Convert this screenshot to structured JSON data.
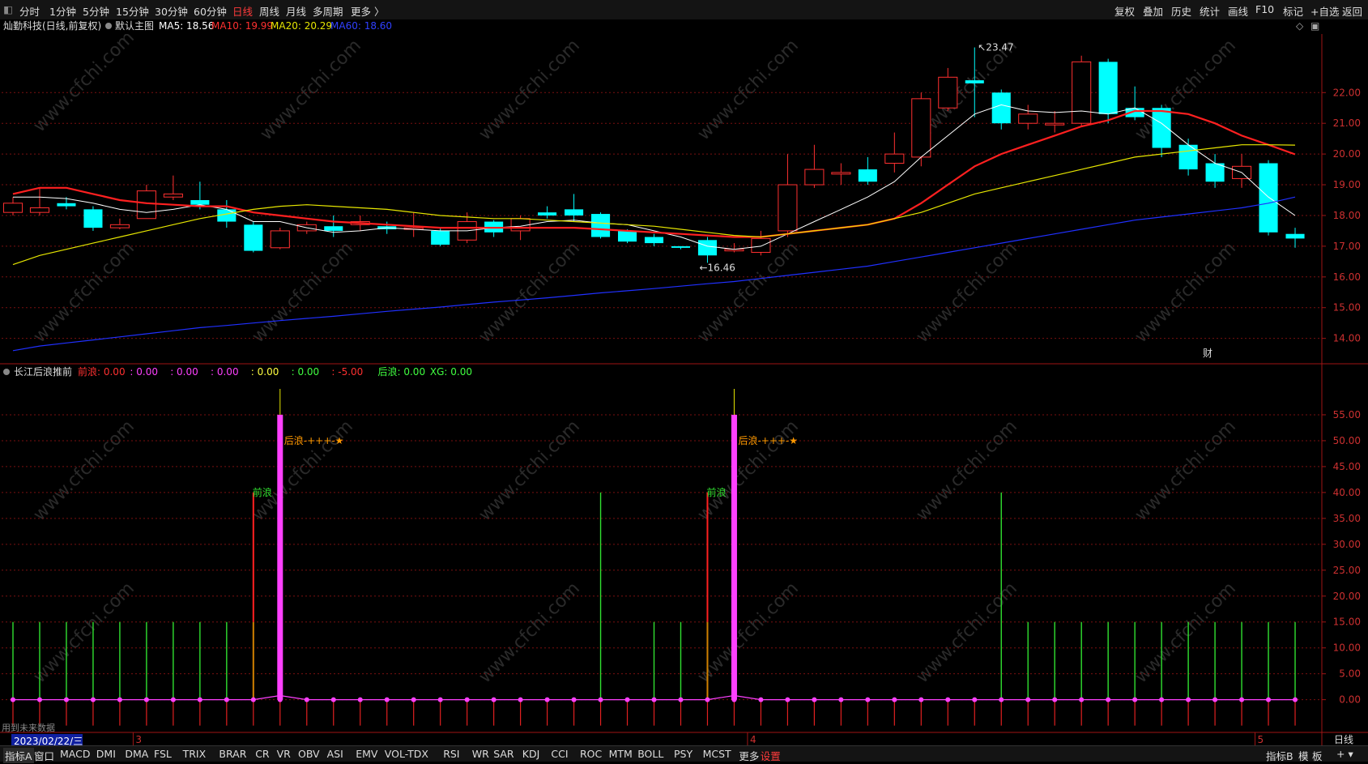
{
  "toolbar": {
    "periods": [
      "分时",
      "1分钟",
      "5分钟",
      "15分钟",
      "30分钟",
      "60分钟",
      "日线",
      "周线",
      "月线",
      "多周期",
      "更多 〉"
    ],
    "active_period": "日线",
    "right_buttons": [
      "复权",
      "叠加",
      "历史",
      "统计",
      "画线",
      "F10",
      "标记",
      "+自选",
      "返回"
    ]
  },
  "main_header": {
    "stock": "灿勤科技(日线,前复权)",
    "template": "默认主图",
    "ma5": "MA5: 18.56",
    "ma10": "MA10: 19.99",
    "ma20": "MA20: 20.29",
    "ma60": "MA60: 18.60"
  },
  "sub_header": {
    "name": "长江后浪推前",
    "items": [
      {
        "text": "前浪: 0.00",
        "color": "#ff3030"
      },
      {
        "text": ": 0.00",
        "color": "#ff40ff"
      },
      {
        "text": ": 0.00",
        "color": "#ff40ff"
      },
      {
        "text": ": 0.00",
        "color": "#ff40ff"
      },
      {
        "text": ": 0.00",
        "color": "#ffff40"
      },
      {
        "text": ": 0.00",
        "color": "#40ff40"
      },
      {
        "text": ": -5.00",
        "color": "#ff3030"
      },
      {
        "text": "后浪: 0.00",
        "color": "#40ff40"
      },
      {
        "text": "XG: 0.00",
        "color": "#40ff40"
      }
    ]
  },
  "annotations": {
    "high_label": "23.47",
    "low_label": "16.46",
    "cai_badge": "财",
    "qianlang": "前浪",
    "houlang": "后浪-+++-★",
    "watermark": "www.cfchi.com"
  },
  "x_axis": {
    "date_label": "2023/02/22/三",
    "month_marks": [
      {
        "label": "3",
        "index": 5
      },
      {
        "label": "4",
        "index": 28
      },
      {
        "label": "5",
        "index": 47
      }
    ],
    "period_label": "日线",
    "future_data": "用到未来数据"
  },
  "bottom_tabs": {
    "left": "指标A",
    "window": "窗口",
    "items": [
      "MACD",
      "DMI",
      "DMA",
      "FSL",
      "TRIX",
      "BRAR",
      "CR",
      "VR",
      "OBV",
      "ASI",
      "EMV",
      "VOL-TDX",
      "RSI",
      "WR",
      "SAR",
      "KDJ",
      "CCI",
      "ROC",
      "MTM",
      "BOLL",
      "PSY",
      "MCST",
      "更多",
      "设置"
    ],
    "active": "设置",
    "right": [
      "指标B",
      "模",
      "板"
    ]
  },
  "colors": {
    "up": "#ff3030",
    "down": "#00ffff",
    "ma5": "#ffffff",
    "ma10": "#ff2020",
    "ma20": "#e6e600",
    "ma60": "#2030ff",
    "grid": "#7a1010",
    "axis_text": "#cc3030"
  },
  "chart_data": [
    {
      "type": "candlestick",
      "title": "灿勤科技(日线,前复权)",
      "ylim": [
        13.2,
        23.8
      ],
      "y_ticks": [
        14,
        15,
        16,
        17,
        18,
        19,
        20,
        21,
        22
      ],
      "y_tick_labels": [
        "14.00",
        "15.00",
        "16.00",
        "17.00",
        "18.00",
        "19.00",
        "20.00",
        "21.00",
        "22.00"
      ],
      "candles": [
        {
          "o": 18.1,
          "c": 18.4,
          "h": 18.6,
          "l": 18.0
        },
        {
          "o": 18.1,
          "c": 18.25,
          "h": 18.9,
          "l": 18.0
        },
        {
          "o": 18.4,
          "c": 18.3,
          "h": 18.6,
          "l": 18.2
        },
        {
          "o": 18.2,
          "c": 17.6,
          "h": 18.3,
          "l": 17.5
        },
        {
          "o": 17.6,
          "c": 17.7,
          "h": 17.9,
          "l": 17.55
        },
        {
          "o": 17.9,
          "c": 18.8,
          "h": 19.0,
          "l": 17.9
        },
        {
          "o": 18.6,
          "c": 18.7,
          "h": 19.3,
          "l": 18.5
        },
        {
          "o": 18.5,
          "c": 18.35,
          "h": 19.1,
          "l": 18.2
        },
        {
          "o": 18.2,
          "c": 17.8,
          "h": 18.5,
          "l": 17.6
        },
        {
          "o": 17.7,
          "c": 16.85,
          "h": 17.8,
          "l": 16.8
        },
        {
          "o": 16.95,
          "c": 17.5,
          "h": 17.6,
          "l": 16.9
        },
        {
          "o": 17.5,
          "c": 17.7,
          "h": 17.8,
          "l": 17.4
        },
        {
          "o": 17.65,
          "c": 17.5,
          "h": 18.0,
          "l": 17.3
        },
        {
          "o": 17.7,
          "c": 17.8,
          "h": 18.0,
          "l": 17.5
        },
        {
          "o": 17.65,
          "c": 17.55,
          "h": 17.8,
          "l": 17.4
        },
        {
          "o": 17.6,
          "c": 17.6,
          "h": 18.1,
          "l": 17.3
        },
        {
          "o": 17.5,
          "c": 17.05,
          "h": 17.6,
          "l": 17.0
        },
        {
          "o": 17.2,
          "c": 17.8,
          "h": 18.1,
          "l": 17.1
        },
        {
          "o": 17.8,
          "c": 17.45,
          "h": 17.85,
          "l": 17.3
        },
        {
          "o": 17.5,
          "c": 17.9,
          "h": 18.0,
          "l": 17.2
        },
        {
          "o": 18.1,
          "c": 18.0,
          "h": 18.3,
          "l": 17.9
        },
        {
          "o": 18.2,
          "c": 18.0,
          "h": 18.7,
          "l": 17.8
        },
        {
          "o": 18.05,
          "c": 17.3,
          "h": 18.1,
          "l": 17.25
        },
        {
          "o": 17.5,
          "c": 17.15,
          "h": 17.55,
          "l": 17.1
        },
        {
          "o": 17.3,
          "c": 17.1,
          "h": 17.4,
          "l": 17.0
        },
        {
          "o": 17.0,
          "c": 16.95,
          "h": 17.0,
          "l": 16.9
        },
        {
          "o": 17.2,
          "c": 16.7,
          "h": 17.3,
          "l": 16.46
        },
        {
          "o": 16.9,
          "c": 16.9,
          "h": 17.1,
          "l": 16.8
        },
        {
          "o": 16.8,
          "c": 17.25,
          "h": 17.5,
          "l": 16.7
        },
        {
          "o": 17.5,
          "c": 19.0,
          "h": 20.0,
          "l": 17.3
        },
        {
          "o": 19.0,
          "c": 19.5,
          "h": 20.3,
          "l": 18.9
        },
        {
          "o": 19.4,
          "c": 19.4,
          "h": 19.7,
          "l": 19.0
        },
        {
          "o": 19.5,
          "c": 19.1,
          "h": 19.9,
          "l": 19.0
        },
        {
          "o": 19.7,
          "c": 20.0,
          "h": 20.7,
          "l": 19.4
        },
        {
          "o": 19.9,
          "c": 21.8,
          "h": 22.0,
          "l": 19.6
        },
        {
          "o": 21.5,
          "c": 22.5,
          "h": 22.8,
          "l": 21.4
        },
        {
          "o": 22.4,
          "c": 22.3,
          "h": 23.47,
          "l": 21.2
        },
        {
          "o": 22.0,
          "c": 21.0,
          "h": 22.1,
          "l": 20.8
        },
        {
          "o": 21.0,
          "c": 21.3,
          "h": 21.6,
          "l": 20.8
        },
        {
          "o": 21.0,
          "c": 21.0,
          "h": 21.4,
          "l": 20.7
        },
        {
          "o": 21.0,
          "c": 23.0,
          "h": 23.2,
          "l": 20.9
        },
        {
          "o": 23.0,
          "c": 21.3,
          "h": 23.1,
          "l": 21.0
        },
        {
          "o": 21.5,
          "c": 21.2,
          "h": 22.2,
          "l": 21.1
        },
        {
          "o": 21.5,
          "c": 20.2,
          "h": 21.6,
          "l": 19.9
        },
        {
          "o": 20.3,
          "c": 19.5,
          "h": 20.5,
          "l": 19.3
        },
        {
          "o": 19.7,
          "c": 19.1,
          "h": 20.0,
          "l": 18.9
        },
        {
          "o": 19.2,
          "c": 19.6,
          "h": 20.0,
          "l": 18.9
        },
        {
          "o": 19.7,
          "c": 17.45,
          "h": 19.8,
          "l": 17.35
        },
        {
          "o": 17.4,
          "c": 17.25,
          "h": 17.6,
          "l": 16.95
        }
      ],
      "series": [
        {
          "name": "MA5",
          "values": [
            18.6,
            18.6,
            18.55,
            18.4,
            18.2,
            18.1,
            18.2,
            18.35,
            18.2,
            17.8,
            17.8,
            17.6,
            17.45,
            17.5,
            17.6,
            17.55,
            17.5,
            17.5,
            17.6,
            17.65,
            17.8,
            17.85,
            17.75,
            17.7,
            17.5,
            17.3,
            17.0,
            16.9,
            17.0,
            17.4,
            17.8,
            18.2,
            18.6,
            19.1,
            19.9,
            20.6,
            21.3,
            21.6,
            21.4,
            21.35,
            21.4,
            21.3,
            21.5,
            21.0,
            20.3,
            19.7,
            19.4,
            18.6,
            18.0
          ]
        },
        {
          "name": "MA10",
          "values": [
            18.7,
            18.9,
            18.9,
            18.7,
            18.5,
            18.4,
            18.35,
            18.3,
            18.3,
            18.1,
            18.0,
            17.9,
            17.8,
            17.75,
            17.7,
            17.65,
            17.6,
            17.6,
            17.6,
            17.6,
            17.6,
            17.6,
            17.55,
            17.5,
            17.45,
            17.4,
            17.35,
            17.3,
            17.3,
            17.4,
            17.5,
            17.6,
            17.7,
            17.9,
            18.4,
            19.0,
            19.6,
            20.0,
            20.3,
            20.6,
            20.9,
            21.1,
            21.4,
            21.4,
            21.3,
            21.0,
            20.6,
            20.3,
            19.99
          ]
        },
        {
          "name": "MA20",
          "values": [
            16.4,
            16.7,
            16.9,
            17.1,
            17.3,
            17.5,
            17.7,
            17.9,
            18.05,
            18.2,
            18.3,
            18.35,
            18.3,
            18.25,
            18.2,
            18.1,
            18.0,
            17.95,
            17.9,
            17.9,
            17.85,
            17.8,
            17.75,
            17.7,
            17.65,
            17.55,
            17.45,
            17.35,
            17.3,
            17.4,
            17.5,
            17.6,
            17.7,
            17.9,
            18.1,
            18.4,
            18.7,
            18.9,
            19.1,
            19.3,
            19.5,
            19.7,
            19.9,
            20.0,
            20.1,
            20.2,
            20.3,
            20.3,
            20.29
          ]
        },
        {
          "name": "MA60",
          "values": [
            13.6,
            13.75,
            13.85,
            13.95,
            14.05,
            14.15,
            14.25,
            14.35,
            14.42,
            14.5,
            14.58,
            14.65,
            14.72,
            14.8,
            14.88,
            14.95,
            15.02,
            15.1,
            15.18,
            15.25,
            15.32,
            15.4,
            15.48,
            15.55,
            15.62,
            15.7,
            15.78,
            15.85,
            15.95,
            16.05,
            16.15,
            16.25,
            16.35,
            16.5,
            16.65,
            16.8,
            16.95,
            17.1,
            17.25,
            17.4,
            17.55,
            17.7,
            17.85,
            17.95,
            18.05,
            18.15,
            18.25,
            18.4,
            18.6
          ]
        }
      ]
    },
    {
      "type": "bar",
      "title": "长江后浪推前",
      "ylim": [
        -6,
        60
      ],
      "y_ticks": [
        0,
        5,
        10,
        15,
        20,
        25,
        30,
        35,
        40,
        45,
        50,
        55
      ],
      "y_tick_labels": [
        "0.00",
        "5.00",
        "10.00",
        "15.00",
        "20.00",
        "25.00",
        "30.00",
        "35.00",
        "40.00",
        "45.00",
        "50.00",
        "55.00"
      ],
      "green_bars": [
        15,
        15,
        15,
        15,
        15,
        15,
        15,
        15,
        15,
        0,
        0,
        0,
        0,
        0,
        0,
        0,
        0,
        0,
        0,
        0,
        0,
        0,
        40,
        0,
        15,
        15,
        15,
        0,
        0,
        0,
        0,
        0,
        0,
        0,
        0,
        0,
        0,
        0,
        0,
        0,
        0,
        0,
        0,
        0,
        0,
        0,
        0,
        0,
        15
      ],
      "green_bars_tail": [
        0,
        0,
        0,
        0,
        0,
        0,
        0,
        0,
        0,
        0,
        0,
        0,
        0,
        0,
        0,
        0,
        0,
        0,
        0,
        0,
        0,
        0,
        0,
        0,
        0,
        0,
        0,
        0,
        0,
        0,
        0,
        0,
        0,
        0,
        0,
        0,
        0,
        40,
        15,
        15,
        15,
        15,
        15,
        15,
        15,
        15,
        15,
        15,
        15
      ],
      "red_bars": [
        0,
        0,
        0,
        0,
        0,
        0,
        0,
        0,
        0,
        40,
        0,
        0,
        0,
        0,
        0,
        0,
        0,
        0,
        0,
        0,
        0,
        0,
        0,
        0,
        0,
        0,
        40,
        0,
        0,
        0,
        0,
        0,
        0,
        0,
        0,
        0,
        0,
        0,
        0,
        0,
        0,
        0,
        0,
        0,
        0,
        0,
        0,
        0,
        0
      ],
      "magenta_bars": [
        0,
        0,
        0,
        0,
        0,
        0,
        0,
        0,
        0,
        0,
        55,
        0,
        0,
        0,
        0,
        0,
        0,
        0,
        0,
        0,
        0,
        0,
        0,
        0,
        0,
        0,
        0,
        55,
        0,
        0,
        0,
        0,
        0,
        0,
        0,
        0,
        0,
        0,
        0,
        0,
        0,
        0,
        0,
        0,
        0,
        0,
        0,
        0,
        0
      ],
      "neg_bars": [
        -5,
        -5,
        -5,
        -5,
        -5,
        -5,
        -5,
        -5,
        -5,
        -5,
        -5,
        -5,
        -5,
        -5,
        -5,
        -5,
        -5,
        -5,
        -5,
        -5,
        -5,
        -5,
        -5,
        -5,
        -5,
        -5,
        -5,
        -5,
        -5,
        -5,
        -5,
        -5,
        -5,
        -5,
        -5,
        -5,
        -5,
        -5,
        -5,
        -5,
        -5,
        -5,
        -5,
        -5,
        -5,
        -5,
        -5,
        -5,
        -5
      ]
    }
  ]
}
